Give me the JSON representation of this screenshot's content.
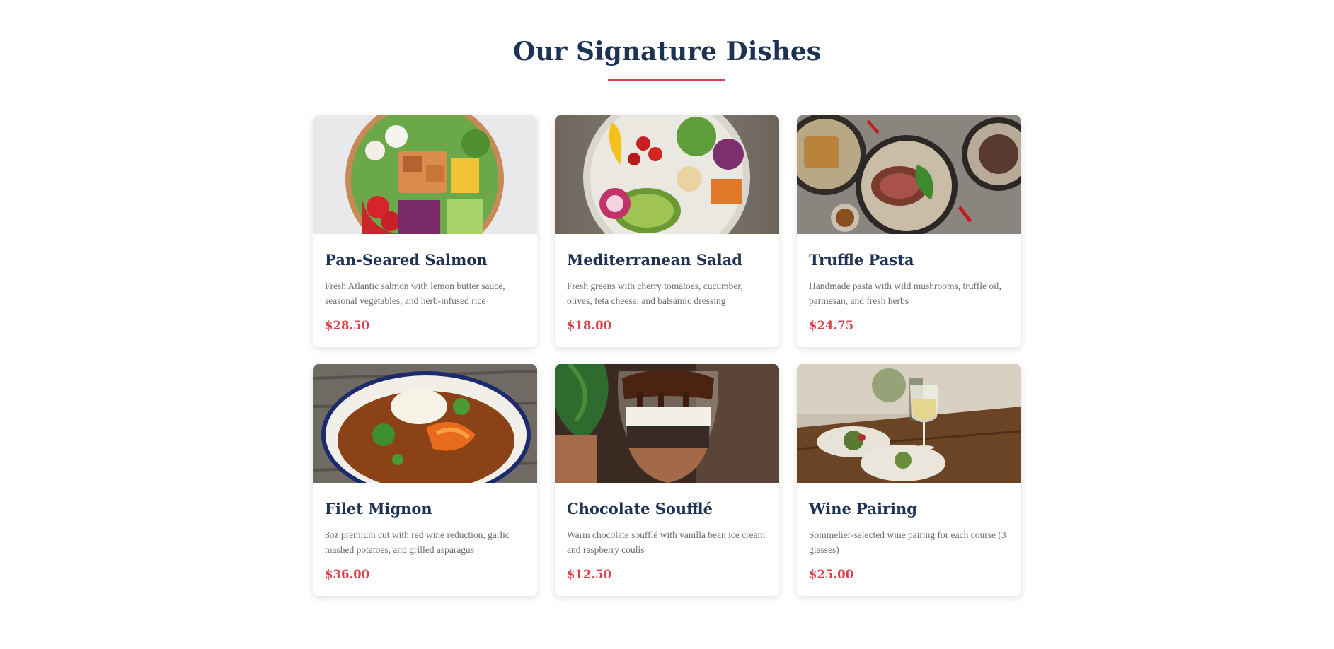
{
  "section": {
    "title": "Our Signature Dishes",
    "accent_color": "#d9424b",
    "heading_color": "#1e3354"
  },
  "dishes": [
    {
      "name": "Pan-Seared Salmon",
      "description": "Fresh Atlantic salmon with lemon butter sauce, seasonal vegetables, and herb-infused rice",
      "price": "$28.50",
      "image": "salmon-poke-bowl-photo"
    },
    {
      "name": "Mediterranean Salad",
      "description": "Fresh greens with cherry tomatoes, cucumber, olives, feta cheese, and balsamic dressing",
      "price": "$18.00",
      "image": "veggie-buddha-bowl-photo"
    },
    {
      "name": "Truffle Pasta",
      "description": "Handmade pasta with wild mushrooms, truffle oil, parmesan, and fresh herbs",
      "price": "$24.75",
      "image": "steak-plates-spread-photo"
    },
    {
      "name": "Filet Mignon",
      "description": "8oz premium cut with red wine reduction, garlic mashed potatoes, and grilled asparagus",
      "price": "$36.00",
      "image": "shrimp-curry-bowl-photo"
    },
    {
      "name": "Chocolate Soufflé",
      "description": "Warm chocolate soufflé with vanilla bean ice cream and raspberry coulis",
      "price": "$12.50",
      "image": "chocolate-parfait-glass-photo"
    },
    {
      "name": "Wine Pairing",
      "description": "Sommelier-selected wine pairing for each course (3 glasses)",
      "price": "$25.00",
      "image": "wine-glass-table-photo"
    }
  ]
}
